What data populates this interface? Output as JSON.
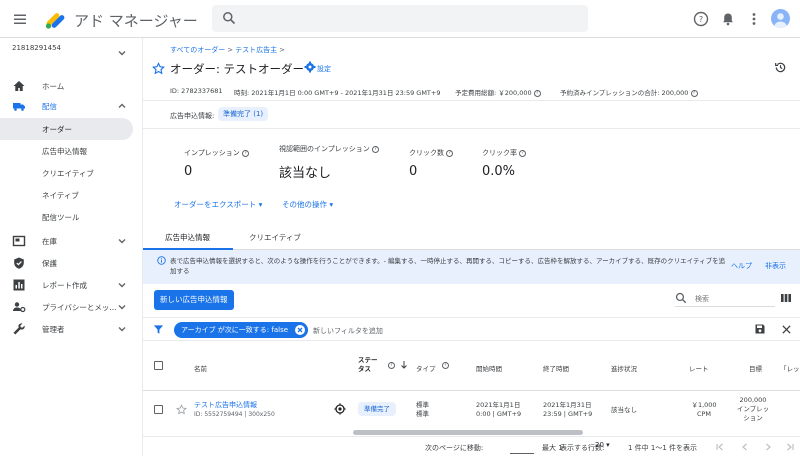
{
  "app": {
    "title": "アド マネージャー"
  },
  "search": {
    "placeholder": ""
  },
  "sidebar": {
    "network_id": "21818291454",
    "items": [
      {
        "label": "ホーム",
        "icon": "home-icon"
      },
      {
        "label": "配信",
        "icon": "delivery-truck-icon"
      },
      {
        "label": "在庫",
        "icon": "inventory-icon"
      },
      {
        "label": "保護",
        "icon": "shield-icon"
      },
      {
        "label": "レポート作成",
        "icon": "report-icon"
      },
      {
        "label": "プライバシーとメッ...",
        "icon": "privacy-icon"
      },
      {
        "label": "管理者",
        "icon": "wrench-icon"
      }
    ],
    "delivery_sub": [
      {
        "label": "オーダー"
      },
      {
        "label": "広告申込情報"
      },
      {
        "label": "クリエイティブ"
      },
      {
        "label": "ネイティブ"
      },
      {
        "label": "配信ツール"
      }
    ]
  },
  "breadcrumb": {
    "all_orders": "すべてのオーダー",
    "advertiser": "テスト広告主",
    "sep": ">"
  },
  "order": {
    "title": "オーダー: テストオーダー",
    "settings_label": "設定",
    "id": "ID: 2782337681",
    "period": "時刻: 2021年1月1日 0:00 GMT+9 - 2021年1月31日 23:59 GMT+9",
    "budget": "予定費用総額: ￥200,000",
    "reserved": "予約済みインプレッションの合計: 200,000"
  },
  "line_item_status": {
    "label": "広告申込情報:",
    "chip": "準備完了 (1)"
  },
  "stats": [
    {
      "label": "インプレッション",
      "value": "0"
    },
    {
      "label": "視認範囲のインプレッション",
      "value": "該当なし"
    },
    {
      "label": "クリック数",
      "value": "0"
    },
    {
      "label": "クリック率",
      "value": "0.0%"
    }
  ],
  "actions": {
    "export": "オーダーをエクスポート",
    "other": "その他の操作"
  },
  "tabs": [
    {
      "label": "広告申込情報"
    },
    {
      "label": "クリエイティブ"
    }
  ],
  "info": {
    "text": "表で広告申込情報を選択すると、次のような操作を行うことができます。- 編集する、一時停止する、再開する、コピーする、広告枠を解放する、アーカイブする、既存のクリエイティブを追加する",
    "help": "ヘルプ",
    "hide": "非表示"
  },
  "table": {
    "new_button": "新しい広告申込情報",
    "search_placeholder": "検索",
    "filter_chip": "アーカイブ が次に一致する: false",
    "add_filter": "新しいフィルタを追加",
    "headers": {
      "name": "名前",
      "status": "ステータス",
      "type": "タイプ",
      "start": "開始時間",
      "end": "終了時間",
      "progress": "進捗状況",
      "rate": "レート",
      "goal": "目標",
      "extra": "「レッ"
    },
    "rows": [
      {
        "name": "テスト広告申込情報",
        "id": "ID: 5552759494 | 300x250",
        "status": "準備完了",
        "type_1": "標準",
        "type_2": "標準",
        "start_1": "2021年1月1日",
        "start_2": "0:00 | GMT+9",
        "end_1": "2021年1月31日",
        "end_2": "23:59 | GMT+9",
        "progress": "該当なし",
        "rate_1": "￥1,000",
        "rate_2": "CPM",
        "goal_1": "200,000",
        "goal_2": "インプレッ",
        "goal_3": "ション"
      }
    ]
  },
  "pagination": {
    "goto_label": "次のページに移動:",
    "max": "最大 1",
    "rows_label": "表示する行数:",
    "rows_value": "20",
    "range": "1 件中 1～1 件を表示"
  },
  "colors": {
    "accent": "#1a73e8",
    "chip_bg": "#e8f0fe",
    "banner_bg": "#e8f0fe"
  }
}
